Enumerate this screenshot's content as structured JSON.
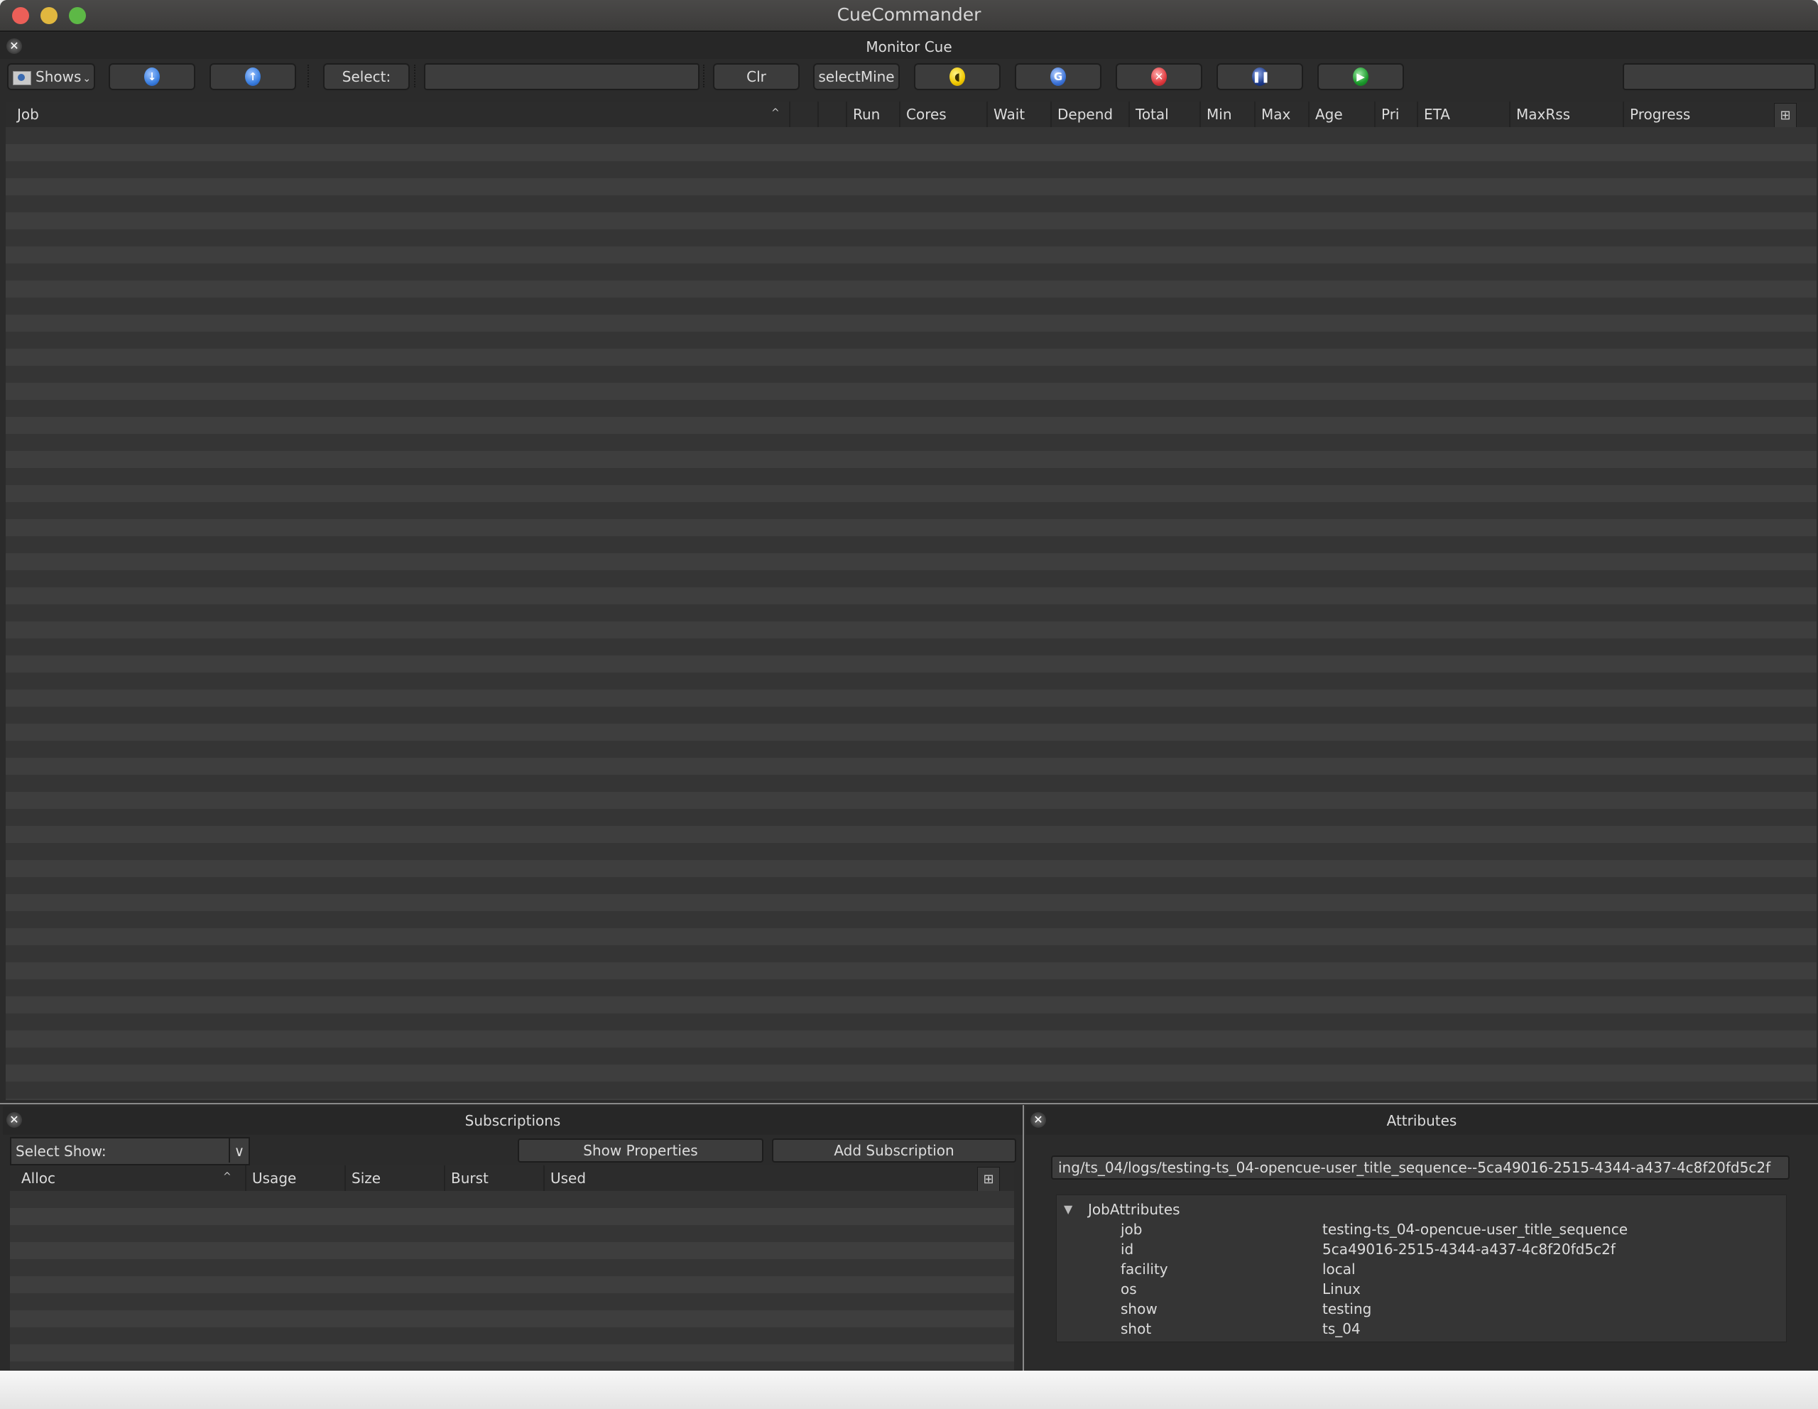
{
  "app": {
    "title": "CueCommander"
  },
  "monitor_cue": {
    "title": "Monitor Cue",
    "toolbar": {
      "shows_label": "Shows",
      "expand_all_icon": "arrow-down-circle-icon",
      "collapse_all_icon": "arrow-up-circle-icon",
      "select_label": "Select:",
      "select_input_value": "",
      "clear_label": "Clr",
      "select_mine_label": "selectMine",
      "eat_icon": "pacman-icon",
      "retry_icon": "retry-g-icon",
      "kill_icon": "kill-x-icon",
      "pause_icon": "pause-icon",
      "unpause_icon": "play-icon",
      "right_field_value": ""
    },
    "columns": [
      "Job",
      "Run",
      "Cores",
      "Wait",
      "Depend",
      "Total",
      "Min",
      "Max",
      "Age",
      "Pri",
      "ETA",
      "MaxRss",
      "Progress"
    ],
    "sort_indicator": "^",
    "rows": []
  },
  "subscriptions": {
    "title": "Subscriptions",
    "select_show_label": "Select Show:",
    "show_properties_label": "Show Properties",
    "add_subscription_label": "Add Subscription",
    "columns": [
      "Alloc",
      "Usage",
      "Size",
      "Burst",
      "Used"
    ],
    "sort_indicator": "^",
    "rows": []
  },
  "attributes": {
    "title": "Attributes",
    "log_path": "ing/ts_04/logs/testing-ts_04-opencue-user_title_sequence--5ca49016-2515-4344-a437-4c8f20fd5c2f",
    "group_label": "JobAttributes",
    "items": [
      {
        "key": "job",
        "value": "testing-ts_04-opencue-user_title_sequence"
      },
      {
        "key": "id",
        "value": "5ca49016-2515-4344-a437-4c8f20fd5c2f"
      },
      {
        "key": "facility",
        "value": "local"
      },
      {
        "key": "os",
        "value": "Linux"
      },
      {
        "key": "show",
        "value": "testing"
      },
      {
        "key": "shot",
        "value": "ts_04"
      }
    ]
  },
  "colors": {
    "window_bg": "#2b2b2b",
    "row_a": "#353535",
    "row_b": "#3e3e3e",
    "expand_blue": "#3b7fe0",
    "eat_yellow": "#f0c800",
    "retry_blue": "#3d74d8",
    "kill_red": "#e0393e",
    "pause_navy": "#1e3c8c",
    "play_green": "#1c9a2c"
  }
}
